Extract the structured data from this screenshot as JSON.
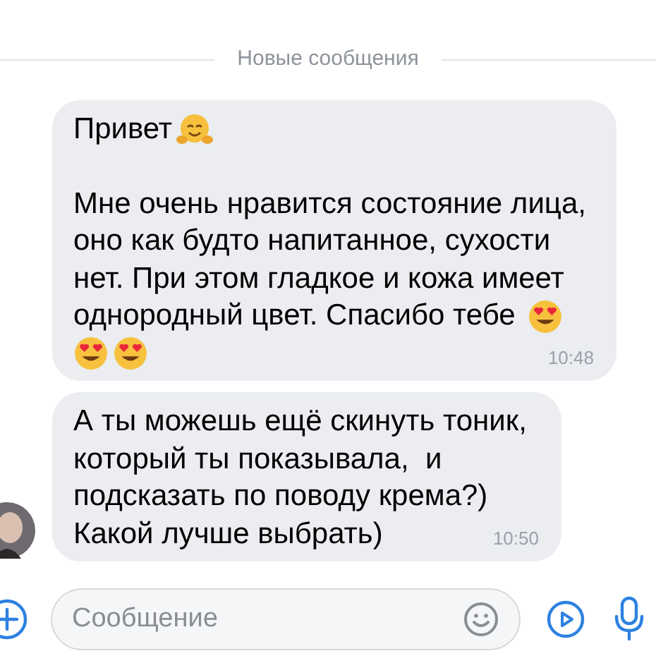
{
  "divider": {
    "label": "Новые сообщения"
  },
  "messages": [
    {
      "paragraphs": [
        [
          [
            {
              "kind": "text",
              "text": "Привет"
            },
            {
              "kind": "hug"
            }
          ]
        ],
        [
          [
            {
              "kind": "text",
              "text": "Мне очень нравится состояние лица,"
            }
          ],
          [
            {
              "kind": "text",
              "text": "оно как будто напитанное, сухости"
            }
          ],
          [
            {
              "kind": "text",
              "text": "нет. При этом гладкое и кожа имеет"
            }
          ],
          [
            {
              "kind": "text",
              "text": "однородный цвет. Спасибо тебе "
            },
            {
              "kind": "heart_eyes"
            }
          ],
          [
            {
              "kind": "heart_eyes"
            },
            {
              "kind": "heart_eyes"
            }
          ]
        ]
      ],
      "time": "10:48",
      "avatar": false
    },
    {
      "paragraphs": [
        [
          [
            {
              "kind": "text",
              "text": "А ты можешь ещё скинуть тоник,"
            }
          ],
          [
            {
              "kind": "text",
              "text": "который ты показывала,  и"
            }
          ],
          [
            {
              "kind": "text",
              "text": "подсказать по поводу крема?)"
            }
          ],
          [
            {
              "kind": "text",
              "text": "Какой лучше выбрать)"
            }
          ]
        ]
      ],
      "time": "10:50",
      "avatar": true
    }
  ],
  "composer": {
    "placeholder": "Сообщение"
  }
}
